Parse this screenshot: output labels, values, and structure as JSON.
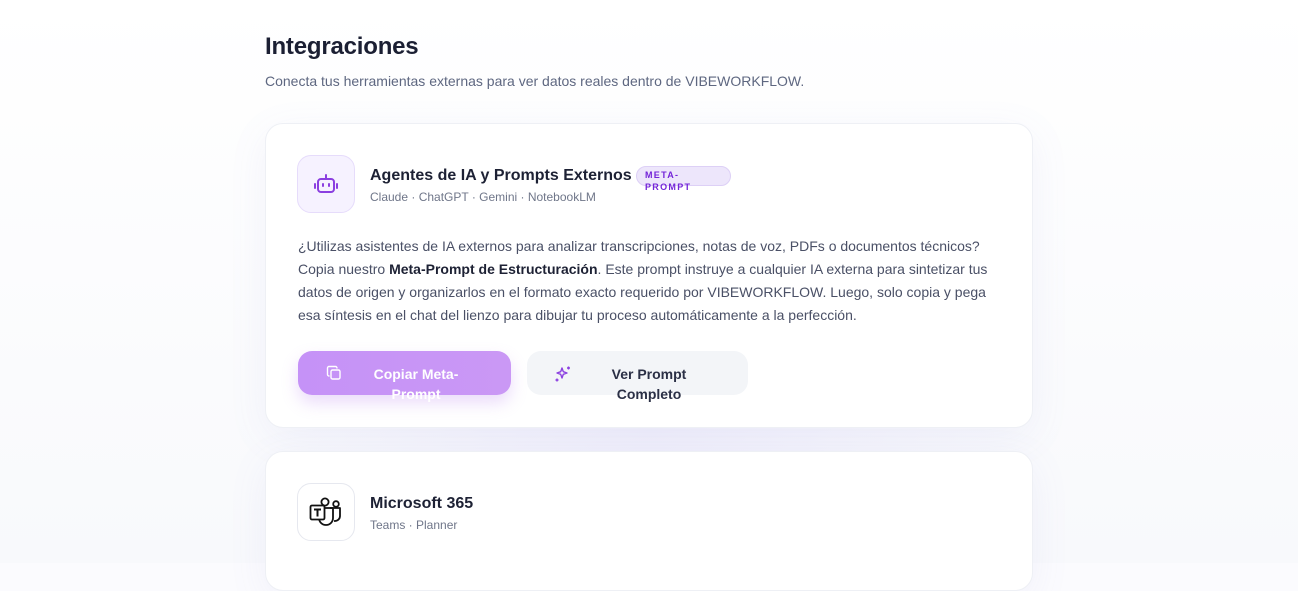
{
  "page": {
    "title": "Integraciones",
    "subtitle": "Conecta tus herramientas externas para ver datos reales dentro de VIBEWORKFLOW."
  },
  "cards": [
    {
      "icon": "robot-icon",
      "name": "Agentes de IA y Prompts Externos",
      "badge": "META-PROMPT",
      "tools": "Claude · ChatGPT · Gemini · NotebookLM",
      "description": {
        "part1": "¿Utilizas asistentes de IA externos para analizar transcripciones, notas de voz, PDFs o documentos técnicos? Copia nuestro ",
        "bold": "Meta-Prompt de Estructuración",
        "part2": ". Este prompt instruye a cualquier IA externa para sintetizar tus datos de origen y organizarlos en el formato exacto requerido por VIBEWORKFLOW. Luego, solo copia y pega esa síntesis en el chat del lienzo para dibujar tu proceso automáticamente a la perfección."
      },
      "buttons": {
        "copy": {
          "label": "Copiar Meta-Prompt",
          "icon": "copy-icon"
        },
        "view": {
          "label": "Ver Prompt Completo",
          "icon": "sparkles-icon"
        }
      }
    },
    {
      "icon": "teams-icon",
      "name": "Microsoft 365",
      "tools": "Teams · Planner"
    }
  ],
  "colors": {
    "accent": "#7425d8",
    "copy_button": "#c592f7",
    "title": "#1b1f33",
    "muted": "#5e6780"
  }
}
